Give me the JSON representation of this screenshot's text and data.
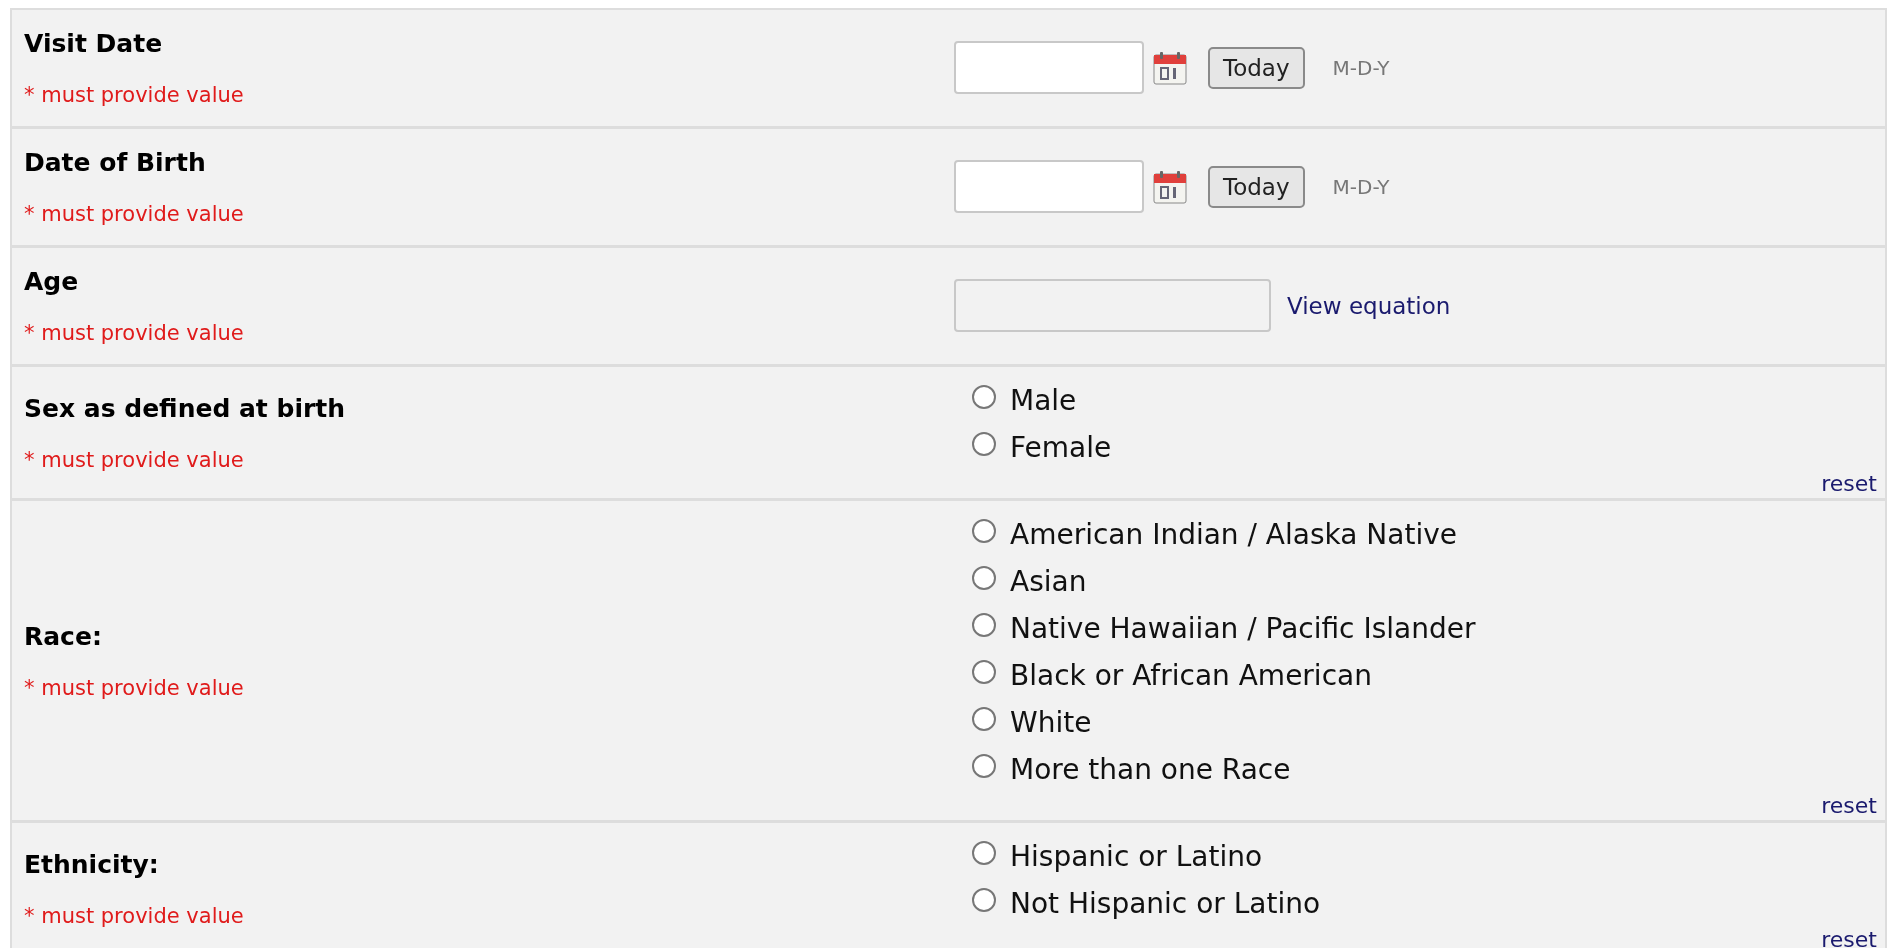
{
  "fields": [
    {
      "kind": "date",
      "label": "Visit Date",
      "required_note": "* must provide value",
      "today_button": "Today",
      "format": "M-D-Y"
    },
    {
      "kind": "date",
      "label": "Date of Birth",
      "required_note": "* must provide value",
      "today_button": "Today",
      "format": "M-D-Y"
    },
    {
      "kind": "calc",
      "label": "Age",
      "required_note": "* must provide value",
      "link": "View equation"
    },
    {
      "kind": "radio",
      "label": "Sex as defined at birth",
      "required_note": "* must provide value",
      "options": [
        {
          "label": "Male",
          "selected": false
        },
        {
          "label": "Female",
          "selected": false
        }
      ],
      "reset": "reset"
    },
    {
      "kind": "radio",
      "label": "Race:",
      "required_note": "* must provide value",
      "options": [
        {
          "label": "American Indian / Alaska Native",
          "selected": false
        },
        {
          "label": "Asian",
          "selected": false
        },
        {
          "label": "Native Hawaiian / Pacific Islander",
          "selected": false
        },
        {
          "label": "Black or African American",
          "selected": false
        },
        {
          "label": "White",
          "selected": false
        },
        {
          "label": "More than one Race",
          "selected": false
        }
      ],
      "reset": "reset"
    },
    {
      "kind": "radio",
      "label": "Ethnicity:",
      "required_note": "* must provide value",
      "options": [
        {
          "label": "Hispanic or Latino",
          "selected": false
        },
        {
          "label": "Not Hispanic or Latino",
          "selected": false
        }
      ],
      "reset": "reset"
    }
  ]
}
